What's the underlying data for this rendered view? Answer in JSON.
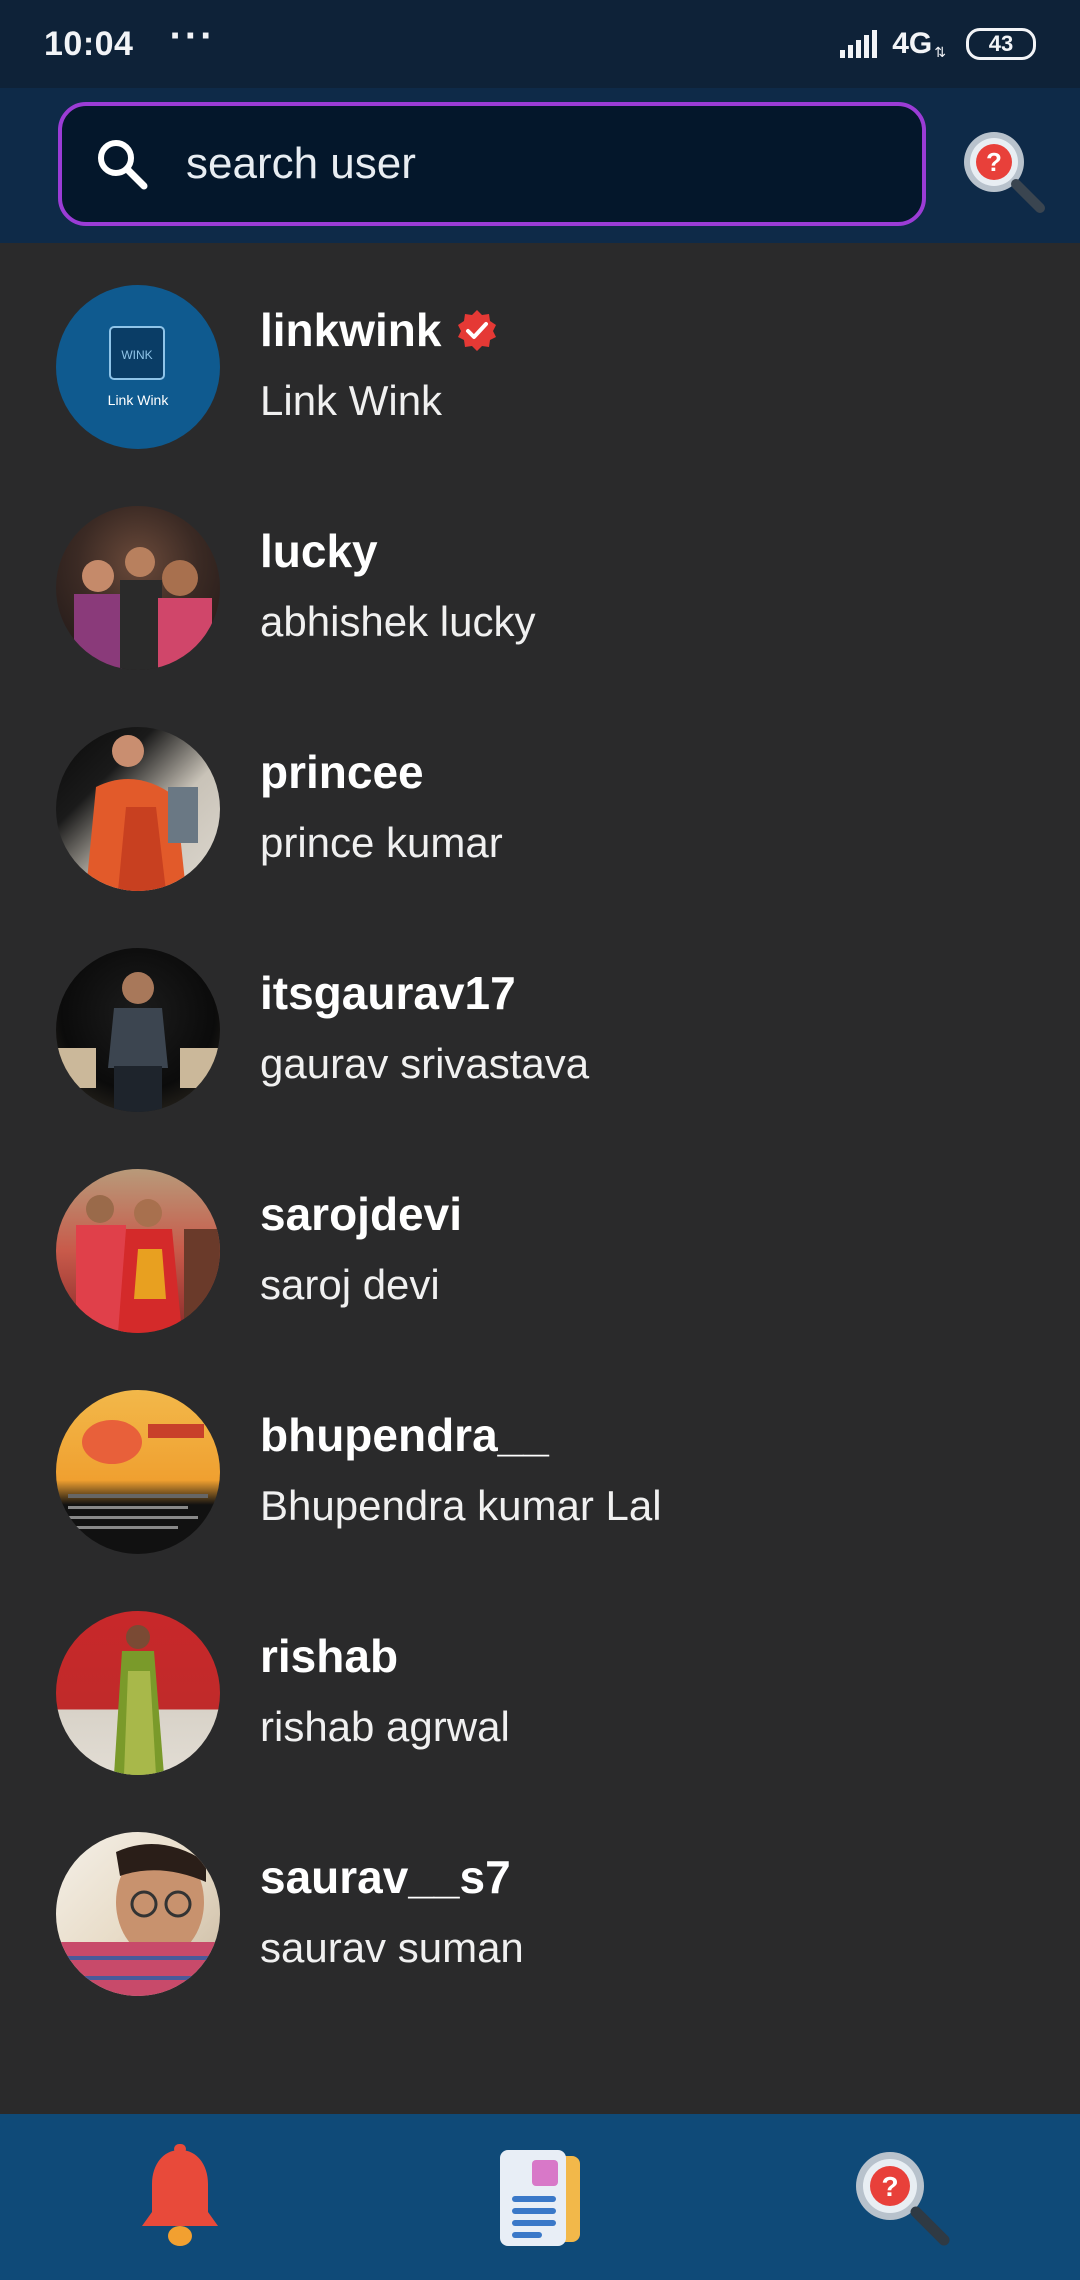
{
  "status_bar": {
    "time": "10:04",
    "dots": "···",
    "network": "4G",
    "battery": "43"
  },
  "search": {
    "placeholder": "search user"
  },
  "users": [
    {
      "username": "linkwink",
      "fullname": "Link Wink",
      "verified": true,
      "avatar_text": "Link Wink",
      "avatar_logo": "WINK"
    },
    {
      "username": "lucky",
      "fullname": "abhishek lucky",
      "verified": false
    },
    {
      "username": "princee",
      "fullname": "prince kumar",
      "verified": false
    },
    {
      "username": "itsgaurav17",
      "fullname": "gaurav srivastava",
      "verified": false
    },
    {
      "username": "sarojdevi",
      "fullname": "saroj devi",
      "verified": false
    },
    {
      "username": "bhupendra__",
      "fullname": "Bhupendra kumar Lal",
      "verified": false
    },
    {
      "username": "rishab",
      "fullname": "rishab agrwal",
      "verified": false
    },
    {
      "username": "saurav__s7",
      "fullname": "saurav suman",
      "verified": false
    }
  ],
  "colors": {
    "background": "#2a2a2b",
    "header": "#0e2a48",
    "search_border": "#9b3cd6",
    "bottom_nav": "#0f4a78",
    "verified": "#e53935",
    "bell": "#e84a3a"
  },
  "icons": {
    "search": "search-icon",
    "help_search": "help-search-icon",
    "verified": "verified-badge-icon",
    "bell": "bell-icon",
    "feed": "feed-document-icon"
  }
}
